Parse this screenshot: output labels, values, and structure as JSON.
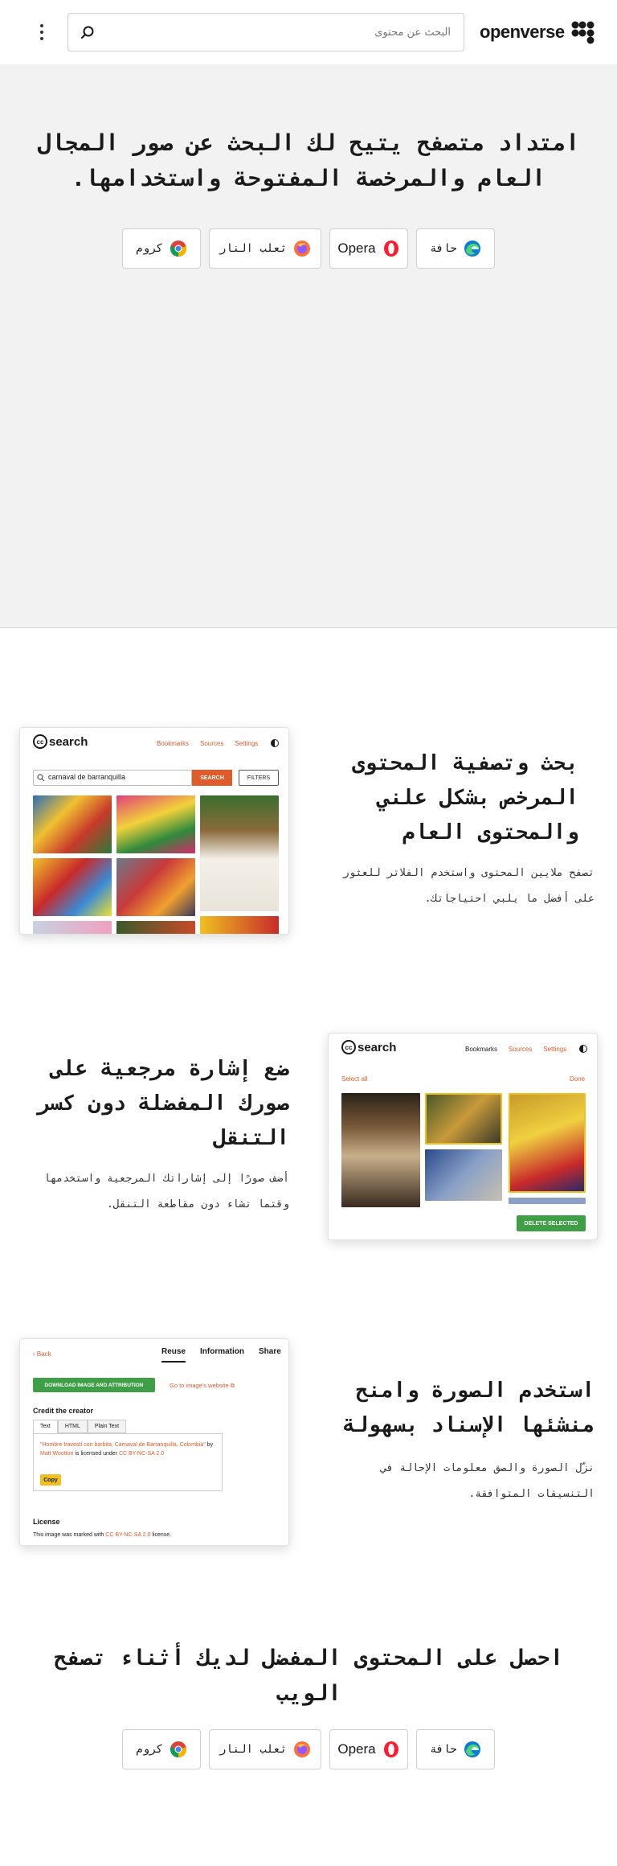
{
  "header": {
    "search_placeholder": "البحث عن محتوى",
    "logo_text": "openverse",
    "menu_icon": "kebab-menu-icon",
    "search_icon": "search-icon"
  },
  "hero": {
    "title": "امتداد متصفح يتيح لك البحث عن صور المجال العام والمرخصة المفتوحة واستخدامها.",
    "browsers": [
      {
        "label": "حافة",
        "icon": "edge-icon"
      },
      {
        "label": "Opera",
        "icon": "opera-icon"
      },
      {
        "label": "ثعلب النار",
        "icon": "firefox-icon"
      },
      {
        "label": "كروم",
        "icon": "chrome-icon"
      }
    ]
  },
  "feature1": {
    "title": "بحث وتصفية المحتوى المرخص بشكل علني والمحتوى العام",
    "desc": "تصفح ملايين المحتوى واستخدم الفلاتر للعثور على أفضل ما يلبي احتياجاتك.",
    "shot": {
      "logo": "search",
      "nav": [
        "Bookmarks",
        "Sources",
        "Settings"
      ],
      "query": "carnaval de barranquilla",
      "search_btn": "SEARCH",
      "filters_btn": "FILTERS"
    }
  },
  "feature2": {
    "title": "ضع إشارة مرجعية على صورك المفضلة دون كسر التنقل",
    "desc": "أضف صورًا إلى إشاراتك المرجعية واستخدمها وقتما تشاء دون مقاطعة التنقل.",
    "shot": {
      "logo": "search",
      "nav": [
        "Bookmarks",
        "Sources",
        "Settings"
      ],
      "select_all": "Select all",
      "done": "Done",
      "delete_btn": "DELETE SELECTED"
    }
  },
  "feature3": {
    "title": "استخدم الصورة وامنح منشئها الإسناد بسهولة",
    "desc": "نزّل الصورة والصق معلومات الإحالة في التنسيقات المتوافقة.",
    "shot": {
      "back": "Back",
      "tabs": [
        "Reuse",
        "Information",
        "Share"
      ],
      "download_btn": "DOWNLOAD IMAGE AND ATTRIBUTION",
      "goto_link": "Go to image's website",
      "credit_heading": "Credit the creator",
      "format_tabs": [
        "Text",
        "HTML",
        "Plain Text"
      ],
      "attribution_title": "\"Hombre travestí con barbita, Carnaval de Barranquilla, Colombia\"",
      "attribution_by": "by",
      "attribution_author": "Matt Wootton",
      "attribution_mid": "is licensed under",
      "attribution_license": "CC BY-NC-SA 2.0",
      "copy_btn": "Copy",
      "license_heading": "License",
      "license_text_pre": "This image was marked with",
      "license_link": "CC BY-NC-SA 2.0",
      "license_text_post": "license."
    }
  },
  "cta": {
    "title": "احصل على المحتوى المفضل لديك أثناء تصفح الويب",
    "browsers": [
      {
        "label": "حافة",
        "icon": "edge-icon"
      },
      {
        "label": "Opera",
        "icon": "opera-icon"
      },
      {
        "label": "ثعلب النار",
        "icon": "firefox-icon"
      },
      {
        "label": "كروم",
        "icon": "chrome-icon"
      }
    ]
  },
  "colors": {
    "accent": "#e05b2a",
    "green": "#3f9f46",
    "hero_bg": "#f2f2f2"
  }
}
